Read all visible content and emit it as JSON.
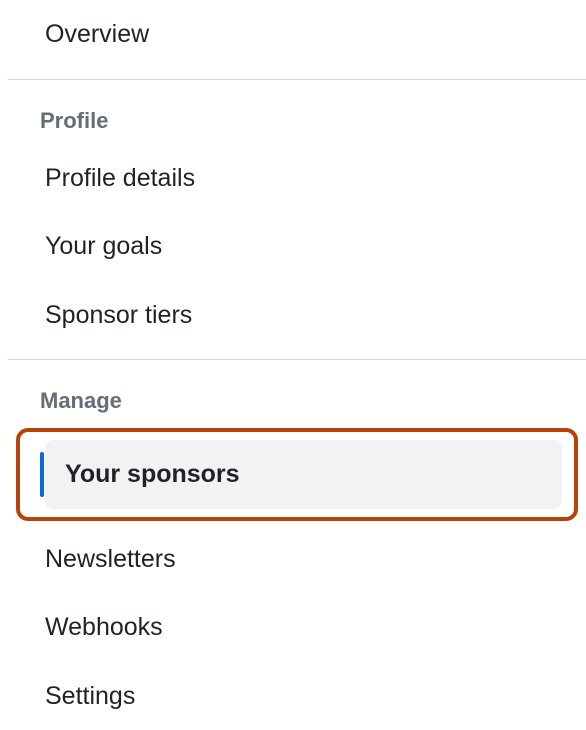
{
  "nav": {
    "overview": "Overview",
    "sections": [
      {
        "label": "Profile",
        "items": [
          {
            "text": "Profile details",
            "selected": false
          },
          {
            "text": "Your goals",
            "selected": false
          },
          {
            "text": "Sponsor tiers",
            "selected": false
          }
        ]
      },
      {
        "label": "Manage",
        "items": [
          {
            "text": "Your sponsors",
            "selected": true,
            "highlighted": true
          },
          {
            "text": "Newsletters",
            "selected": false
          },
          {
            "text": "Webhooks",
            "selected": false
          },
          {
            "text": "Settings",
            "selected": false
          }
        ]
      }
    ]
  }
}
